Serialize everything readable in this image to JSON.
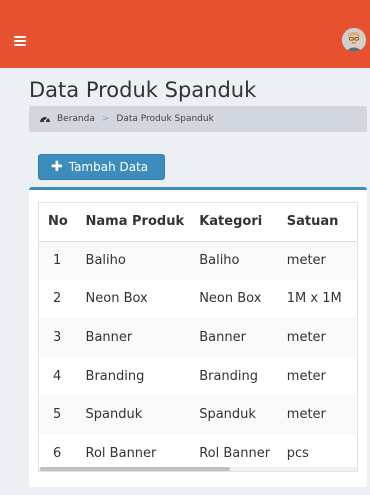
{
  "header": {
    "brand_color": "#e8512f",
    "menu_icon": "hamburger-icon",
    "avatar_icon": "user-avatar-icon"
  },
  "page": {
    "title": "Data Produk Spanduk"
  },
  "breadcrumb": {
    "icon": "dashboard-icon",
    "home": "Beranda",
    "separator": ">",
    "current": "Data Produk Spanduk"
  },
  "toolbar": {
    "add_label": "Tambah Data",
    "add_icon": "plus-icon"
  },
  "table": {
    "headers": [
      "No",
      "Nama Produk",
      "Kategori",
      "Satuan"
    ],
    "rows": [
      [
        "1",
        "Baliho",
        "Baliho",
        "meter"
      ],
      [
        "2",
        "Neon Box",
        "Neon Box",
        "1M x 1M"
      ],
      [
        "3",
        "Banner",
        "Banner",
        "meter"
      ],
      [
        "4",
        "Branding",
        "Branding",
        "meter"
      ],
      [
        "5",
        "Spanduk",
        "Spanduk",
        "meter"
      ],
      [
        "6",
        "Rol Banner",
        "Rol Banner",
        "pcs"
      ]
    ]
  }
}
